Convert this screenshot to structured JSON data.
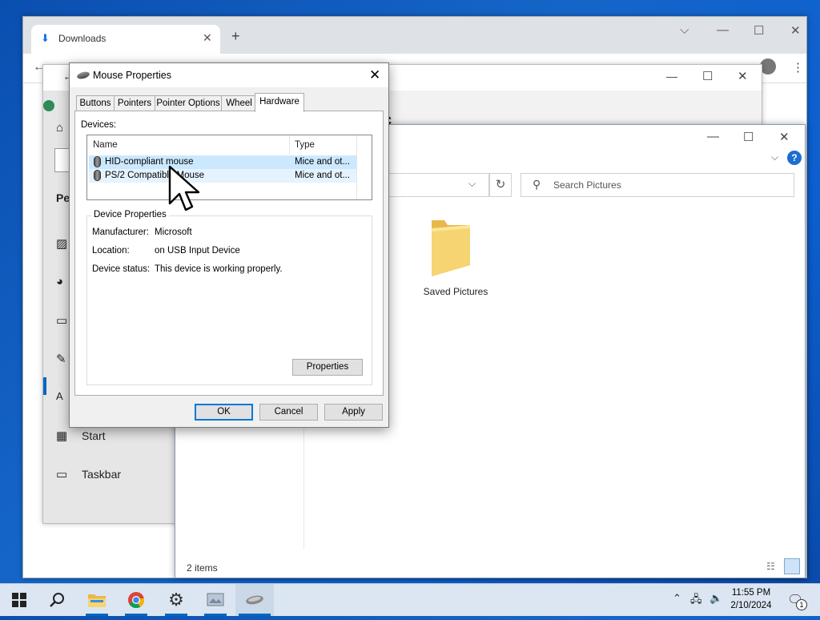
{
  "chrome": {
    "tab_title": "Downloads",
    "new_tab": "+",
    "tabsearch_icon": "chevron-down-icon",
    "back_icon": "arrow-left-icon"
  },
  "settings": {
    "heading_partial": "Pe",
    "nav_items": [
      {
        "icon": "image-icon",
        "label": ""
      },
      {
        "icon": "palette-icon",
        "label": ""
      },
      {
        "icon": "lock-screen-icon",
        "label": ""
      },
      {
        "icon": "themes-icon",
        "label": ""
      },
      {
        "icon": "fonts-icon",
        "label": ""
      },
      {
        "icon": "start-icon",
        "label": "Start"
      },
      {
        "icon": "taskbar-icon",
        "label": "Taskbar"
      }
    ],
    "bg_heading_partial": "c"
  },
  "explorer": {
    "search_placeholder": "Search Pictures",
    "folder_name": "Saved Pictures",
    "status": "2 items"
  },
  "dialog": {
    "title": "Mouse Properties",
    "tabs": [
      "Buttons",
      "Pointers",
      "Pointer Options",
      "Wheel",
      "Hardware"
    ],
    "active_tab": "Hardware",
    "devices_label": "Devices:",
    "columns": {
      "name": "Name",
      "type": "Type"
    },
    "devices": [
      {
        "name": "HID-compliant mouse",
        "type": "Mice and ot..."
      },
      {
        "name": "PS/2 Compatible Mouse",
        "type": "Mice and ot..."
      }
    ],
    "device_properties": {
      "legend": "Device Properties",
      "manufacturer_label": "Manufacturer:",
      "manufacturer": "Microsoft",
      "location_label": "Location:",
      "location": "on USB Input Device",
      "status_label": "Device status:",
      "status": "This device is working properly."
    },
    "properties_button": "Properties",
    "ok": "OK",
    "cancel": "Cancel",
    "apply": "Apply"
  },
  "taskbar": {
    "time": "11:55 PM",
    "date": "2/10/2024",
    "notification_count": "1",
    "colors": {
      "accent": "#0067c0"
    }
  }
}
